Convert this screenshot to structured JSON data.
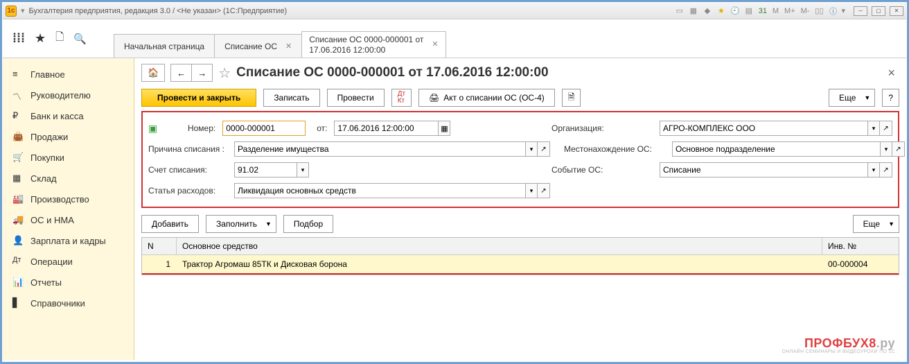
{
  "window": {
    "title": "Бухгалтерия предприятия, редакция 3.0 / <Не указан>  (1С:Предприятие)",
    "m_buttons": [
      "M",
      "M+",
      "M-"
    ]
  },
  "tabs": [
    {
      "label": "Начальная страница",
      "closable": false,
      "active": false
    },
    {
      "label": "Списание ОС",
      "closable": true,
      "active": false
    },
    {
      "label_line1": "Списание ОС 0000-000001 от",
      "label_line2": "17.06.2016 12:00:00",
      "closable": true,
      "active": true
    }
  ],
  "sidebar": {
    "items": [
      {
        "label": "Главное",
        "icon": "menu"
      },
      {
        "label": "Руководителю",
        "icon": "chart"
      },
      {
        "label": "Банк и касса",
        "icon": "ruble"
      },
      {
        "label": "Продажи",
        "icon": "bag"
      },
      {
        "label": "Покупки",
        "icon": "cart"
      },
      {
        "label": "Склад",
        "icon": "boxes"
      },
      {
        "label": "Производство",
        "icon": "factory"
      },
      {
        "label": "ОС и НМА",
        "icon": "truck"
      },
      {
        "label": "Зарплата и кадры",
        "icon": "person"
      },
      {
        "label": "Операции",
        "icon": "ops"
      },
      {
        "label": "Отчеты",
        "icon": "report"
      },
      {
        "label": "Справочники",
        "icon": "book"
      }
    ]
  },
  "page": {
    "title": "Списание ОС 0000-000001 от 17.06.2016 12:00:00"
  },
  "commands": {
    "post_close": "Провести и закрыть",
    "write": "Записать",
    "post": "Провести",
    "print_act": "Акт о списании ОС (ОС-4)",
    "more": "Еще",
    "help": "?"
  },
  "form": {
    "number_label": "Номер:",
    "number_value": "0000-000001",
    "date_label": "от:",
    "date_value": "17.06.2016 12:00:00",
    "org_label": "Организация:",
    "org_value": "АГРО-КОМПЛЕКС ООО",
    "reason_label": "Причина списания :",
    "reason_value": "Разделение имущества",
    "location_label": "Местонахождение ОС:",
    "location_value": "Основное подразделение",
    "account_label": "Счет списания:",
    "account_value": "91.02",
    "event_label": "Событие ОС:",
    "event_value": "Списание",
    "article_label": "Статья расходов:",
    "article_value": "Ликвидация основных средств"
  },
  "table_commands": {
    "add": "Добавить",
    "fill": "Заполнить",
    "select": "Подбор",
    "more": "Еще"
  },
  "table": {
    "headers": {
      "n": "N",
      "name": "Основное средство",
      "inv": "Инв. №"
    },
    "rows": [
      {
        "n": "1",
        "name": "Трактор Агромаш 85ТК и Дисковая борона",
        "inv": "00-000004"
      }
    ]
  },
  "watermark": {
    "main": "ПРОФБУХ8",
    "suffix": ".ру",
    "sub": "ОНЛАЙН СЕМИНАРЫ И ВИДЕОУРОКИ ПО 1С"
  }
}
